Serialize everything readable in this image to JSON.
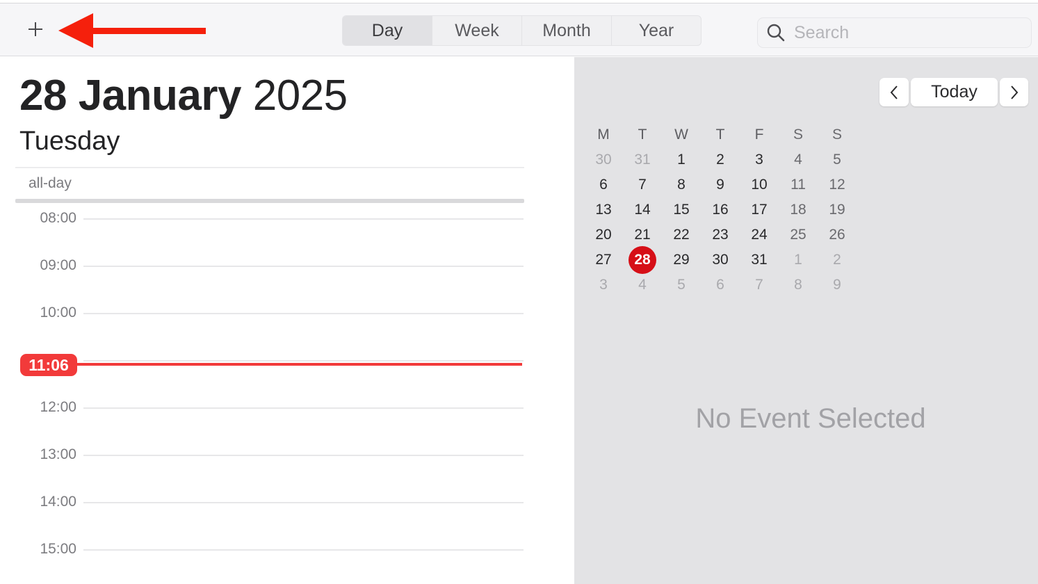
{
  "toolbar": {
    "add_icon": "plus-icon",
    "annotation_arrow": "red-left-arrow",
    "view_tabs": [
      {
        "label": "Day",
        "active": true
      },
      {
        "label": "Week",
        "active": false
      },
      {
        "label": "Month",
        "active": false
      },
      {
        "label": "Year",
        "active": false
      }
    ],
    "search": {
      "placeholder": "Search",
      "value": "",
      "icon": "search-icon"
    }
  },
  "day_view": {
    "date_bold": "28 January",
    "year": "2025",
    "weekday": "Tuesday",
    "allday_label": "all-day",
    "hours": [
      "08:00",
      "09:00",
      "10:00",
      "11:00",
      "12:00",
      "13:00",
      "14:00",
      "15:00"
    ],
    "current_time": "11:06",
    "accent_color": "#f23a3a"
  },
  "side_panel": {
    "nav": {
      "prev_icon": "chevron-left-icon",
      "today_label": "Today",
      "next_icon": "chevron-right-icon"
    },
    "mini_calendar": {
      "weekday_headers": [
        "M",
        "T",
        "W",
        "T",
        "F",
        "S",
        "S"
      ],
      "weeks": [
        [
          {
            "d": "30",
            "o": true
          },
          {
            "d": "31",
            "o": true
          },
          {
            "d": "1"
          },
          {
            "d": "2"
          },
          {
            "d": "3"
          },
          {
            "d": "4"
          },
          {
            "d": "5"
          }
        ],
        [
          {
            "d": "6"
          },
          {
            "d": "7"
          },
          {
            "d": "8"
          },
          {
            "d": "9"
          },
          {
            "d": "10"
          },
          {
            "d": "11"
          },
          {
            "d": "12"
          }
        ],
        [
          {
            "d": "13"
          },
          {
            "d": "14"
          },
          {
            "d": "15"
          },
          {
            "d": "16"
          },
          {
            "d": "17"
          },
          {
            "d": "18"
          },
          {
            "d": "19"
          }
        ],
        [
          {
            "d": "20"
          },
          {
            "d": "21"
          },
          {
            "d": "22"
          },
          {
            "d": "23"
          },
          {
            "d": "24"
          },
          {
            "d": "25"
          },
          {
            "d": "26"
          }
        ],
        [
          {
            "d": "27"
          },
          {
            "d": "28",
            "today": true
          },
          {
            "d": "29"
          },
          {
            "d": "30"
          },
          {
            "d": "31"
          },
          {
            "d": "1",
            "o": true
          },
          {
            "d": "2",
            "o": true
          }
        ],
        [
          {
            "d": "3",
            "o": true
          },
          {
            "d": "4",
            "o": true
          },
          {
            "d": "5",
            "o": true
          },
          {
            "d": "6",
            "o": true
          },
          {
            "d": "7",
            "o": true
          },
          {
            "d": "8",
            "o": true
          },
          {
            "d": "9",
            "o": true
          }
        ]
      ],
      "today_color": "#d60f17"
    },
    "empty_message": "No Event Selected"
  }
}
